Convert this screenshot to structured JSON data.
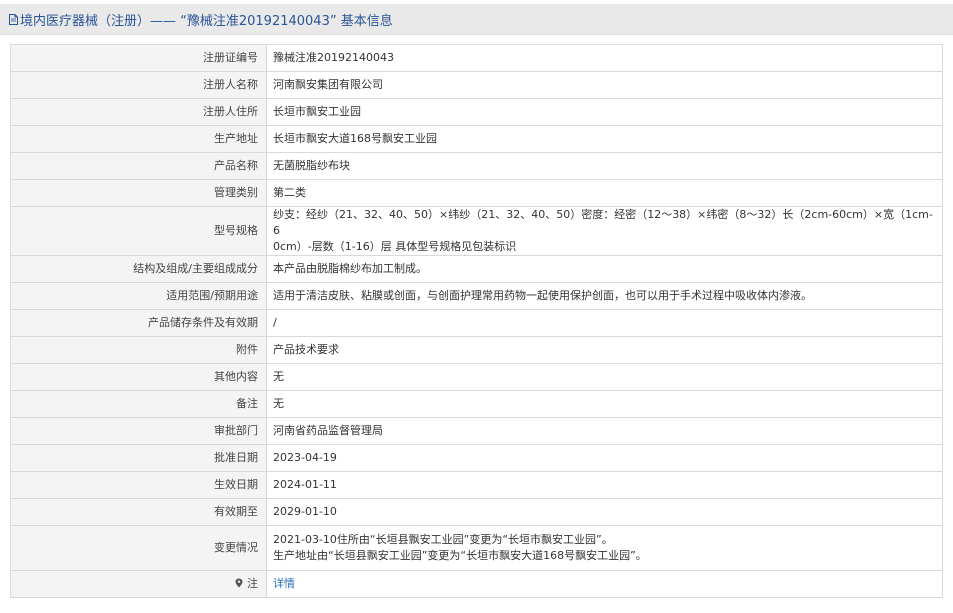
{
  "header": {
    "title": "境内医疗器械（注册）—— “豫械注准20192140043” 基本信息"
  },
  "rows": [
    {
      "label": "注册证编号",
      "value": "豫械注准20192140043"
    },
    {
      "label": "注册人名称",
      "value": "河南飘安集团有限公司"
    },
    {
      "label": "注册人住所",
      "value": "长垣市飘安工业园"
    },
    {
      "label": "生产地址",
      "value": "长垣市飘安大道168号飘安工业园"
    },
    {
      "label": "产品名称",
      "value": "无菌脱脂纱布块"
    },
    {
      "label": "管理类别",
      "value": "第二类"
    },
    {
      "label": "型号规格",
      "value_lines": [
        "纱支：经纱（21、32、40、50）×纬纱（21、32、40、50）密度：经密（12～38）×纬密（8～32）长（2cm-60cm）×宽（1cm-6",
        "0cm）-层数（1-16）层 具体型号规格见包装标识"
      ]
    },
    {
      "label": "结构及组成/主要组成成分",
      "value": "本产品由脱脂棉纱布加工制成。"
    },
    {
      "label": "适用范围/预期用途",
      "value": "适用于清洁皮肤、粘膜或创面，与创面护理常用药物一起使用保护创面，也可以用于手术过程中吸收体内渗液。"
    },
    {
      "label": "产品储存条件及有效期",
      "value": "/"
    },
    {
      "label": "附件",
      "value": "产品技术要求"
    },
    {
      "label": "其他内容",
      "value": "无"
    },
    {
      "label": "备注",
      "value": "无"
    },
    {
      "label": "审批部门",
      "value": "河南省药品监督管理局"
    },
    {
      "label": "批准日期",
      "value": "2023-04-19"
    },
    {
      "label": "生效日期",
      "value": "2024-01-11"
    },
    {
      "label": "有效期至",
      "value": "2029-01-10"
    },
    {
      "label": "变更情况",
      "value_lines": [
        "2021-03-10住所由“长垣县飘安工业园”变更为“长垣市飘安工业园”。",
        "生产地址由“长垣县飘安工业园”变更为“长垣市飘安大道168号飘安工业园”。"
      ]
    },
    {
      "label": "注",
      "value": "详情"
    }
  ],
  "icons": {
    "header_icon": "document-icon",
    "note_icon": "pin-icon"
  },
  "colors": {
    "header_text": "#2a5597",
    "link": "#2a6bc1",
    "label_bg": "#f4f4f4",
    "border": "#d9d9d9"
  }
}
